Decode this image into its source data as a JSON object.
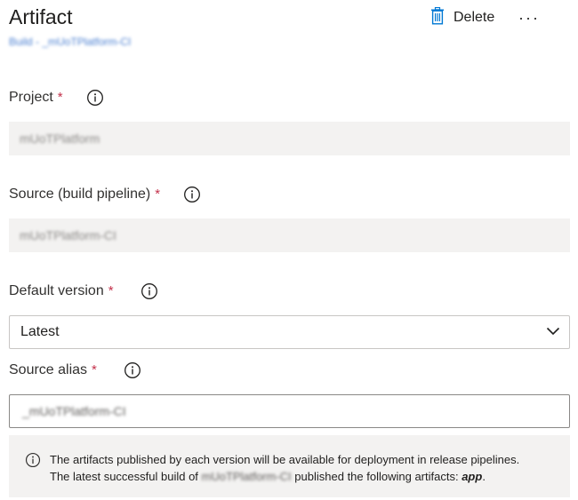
{
  "header": {
    "title": "Artifact",
    "breadcrumb": "Build - _mUoTPlatform-CI",
    "delete_label": "Delete",
    "more_label": "···"
  },
  "fields": {
    "project": {
      "label": "Project",
      "required_mark": "*",
      "value": "mUoTPlatform"
    },
    "source": {
      "label": "Source (build pipeline)",
      "required_mark": "*",
      "value": "mUoTPlatform-CI"
    },
    "default_version": {
      "label": "Default version",
      "required_mark": "*",
      "selected": "Latest"
    },
    "source_alias": {
      "label": "Source alias",
      "required_mark": "*",
      "value": "_mUoTPlatform-CI"
    }
  },
  "info": {
    "line1": "The artifacts published by each version will be available for deployment in release pipelines.",
    "line2_prefix": "The latest successful build of",
    "line2_build": "mUoTPlatform-CI",
    "line2_suffix": "published the following artifacts:",
    "artifact": "app",
    "period": "."
  },
  "icons": {
    "delete": "trash-icon",
    "info": "info-circle-icon",
    "dropdown": "chevron-down-icon"
  },
  "colors": {
    "required": "#c4314b",
    "link": "#4a7fd1",
    "disabled_bg": "#f3f2f1",
    "delete_icon": "#0078d4"
  }
}
